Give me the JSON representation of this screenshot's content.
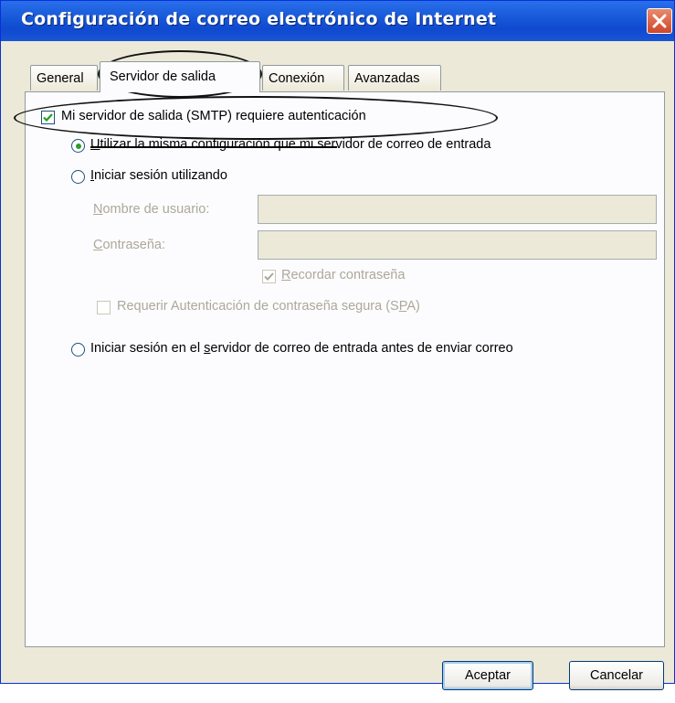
{
  "window": {
    "title": "Configuración de correo electrónico de Internet"
  },
  "tabs": [
    {
      "label": "General"
    },
    {
      "label": "Servidor de salida"
    },
    {
      "label": "Conexión"
    },
    {
      "label": "Avanzadas"
    }
  ],
  "smtp_auth": {
    "label": "Mi servidor de salida (SMTP) requiere autenticación",
    "checked": true
  },
  "options": {
    "same_config": {
      "prefix": "U",
      "rest": "tilizar la misma configuración que mi servidor de correo de entrada",
      "selected": true
    },
    "login_using": {
      "prefix": "I",
      "rest": "niciar sesión utilizando",
      "selected": false
    },
    "login_before_send": {
      "pre": "Iniciar sesión en el ",
      "accel": "s",
      "post": "ervidor de correo de entrada antes de enviar correo",
      "selected": false
    }
  },
  "fields": {
    "username": {
      "accel": "N",
      "rest": "ombre de usuario:",
      "value": ""
    },
    "password": {
      "accel": "C",
      "rest": "ontraseña:",
      "value": ""
    }
  },
  "remember_password": {
    "accel": "R",
    "rest": "ecordar contraseña",
    "checked": true
  },
  "spa": {
    "pre": "Requerir Autenticación de contraseña segura (S",
    "accel": "P",
    "post": "A)",
    "checked": false
  },
  "buttons": {
    "ok": "Aceptar",
    "cancel": "Cancelar"
  }
}
